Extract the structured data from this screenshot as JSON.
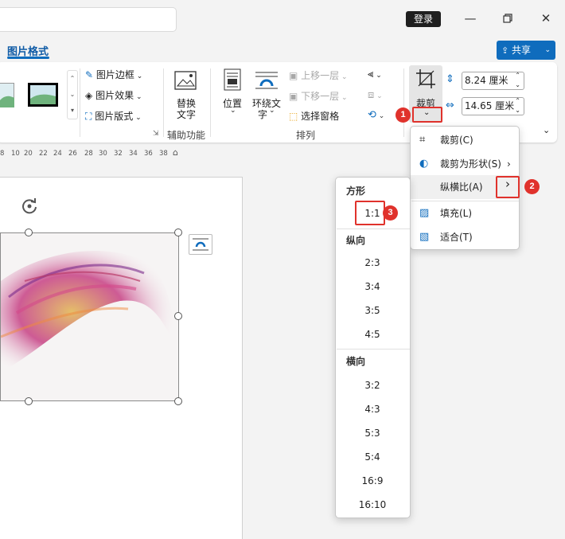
{
  "titlebar": {
    "login": "登录"
  },
  "tabs": {
    "active": "图片格式"
  },
  "share": {
    "label": "共享"
  },
  "ribbon": {
    "picture_border": "图片边框",
    "picture_effects": "图片效果",
    "picture_layout": "图片版式",
    "alt_text_l1": "替换",
    "alt_text_l2": "文字",
    "accessibility_group": "辅助功能",
    "position": "位置",
    "wrap_text_l1": "环绕文",
    "wrap_text_l2": "字",
    "bring_forward": "上移一层",
    "send_backward": "下移一层",
    "selection_pane": "选择窗格",
    "arrange_group": "排列",
    "crop": "裁剪",
    "height_value": "8.24 厘米",
    "width_value": "14.65 厘米"
  },
  "ruler": [
    "8",
    "10",
    "20",
    "22",
    "24",
    "26",
    "28",
    "30",
    "32",
    "34",
    "36",
    "38"
  ],
  "crop_menu": {
    "crop": "裁剪(C)",
    "crop_to_shape": "裁剪为形状(S)",
    "aspect_ratio": "纵横比(A)",
    "fill": "填充(L)",
    "fit": "适合(T)"
  },
  "aspect_menu": {
    "square_header": "方形",
    "square": [
      "1:1"
    ],
    "portrait_header": "纵向",
    "portrait": [
      "2:3",
      "3:4",
      "3:5",
      "4:5"
    ],
    "landscape_header": "横向",
    "landscape": [
      "3:2",
      "4:3",
      "5:3",
      "5:4",
      "16:9",
      "16:10"
    ]
  },
  "badges": [
    "1",
    "2",
    "3"
  ],
  "colors": {
    "accent": "#0f6cbd",
    "highlight": "#e0322c"
  }
}
